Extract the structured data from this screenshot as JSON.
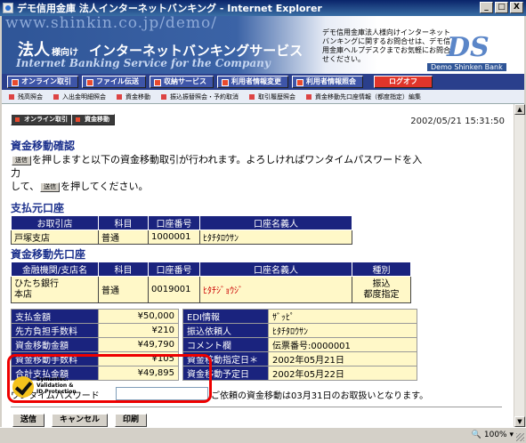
{
  "window": {
    "title": "デモ信用金庫  法人インターネットバンキング - Internet Explorer",
    "min": "_",
    "max": "□",
    "close": "X"
  },
  "header": {
    "url_watermark": "www.shinkin.co.jp/demo/",
    "brand_jp_1": "法人",
    "brand_jp_2": "様向け",
    "brand_jp_3": "インターネットバンキングサービス",
    "brand_en": "Internet Banking Service for the Company",
    "note": "デモ信用金庫法人様向けインターネットバンキングに関するお問合せは、デモ信用金庫ヘルプデスクまでお気軽にお問合せください。",
    "logo": "DS",
    "logo_sub": "Demo Shinken Bank"
  },
  "mainnav": [
    "オンライン取引",
    "ファイル伝送",
    "収納サービス",
    "利用者情報変更",
    "利用者情報照会",
    "ログオフ"
  ],
  "subnav": [
    "残高照会",
    "入出金明細照会",
    "資金移動",
    "振込振替照会・予約取消",
    "取引履歴照会",
    "資金移動先口座情報（都度指定）編集"
  ],
  "breadcrumb": [
    "オンライン取引",
    "資金移動"
  ],
  "datetime": "2002/05/21  15:31:50",
  "confirm": {
    "title": "資金移動確認",
    "mini_send": "送信",
    "text1": "を押しますと以下の資金移動取引が行われます。よろしければワンタイムパスワードを入力",
    "text2": "して、",
    "mini_send2": "送信",
    "text3": "を押してください。"
  },
  "source": {
    "title": "支払元口座",
    "headers": [
      "お取引店",
      "科目",
      "口座番号",
      "口座名義人"
    ],
    "row": [
      "戸塚支店",
      "普通",
      "1000001",
      "ﾋﾀﾁﾀﾛｳｻﾝ"
    ]
  },
  "dest": {
    "title": "資金移動先口座",
    "headers": [
      "金融機関/支店名",
      "科目",
      "口座番号",
      "口座名義人",
      "種別"
    ],
    "bank": "ひたち銀行",
    "branch": "本店",
    "subject": "普通",
    "account": "0019001",
    "holder": "ﾋﾀﾁｼﾞｮｳｼﾞ",
    "kind1": "振込",
    "kind2": "都度指定"
  },
  "summary_left": [
    {
      "label": "支払金額",
      "value": "¥50,000"
    },
    {
      "label": "先方負担手数料",
      "value": "¥210"
    },
    {
      "label": "資金移動金額",
      "value": "¥49,790"
    },
    {
      "label": "資金移動手数料",
      "value": "¥105"
    },
    {
      "label": "合計支払金額",
      "value": "¥49,895"
    }
  ],
  "summary_right": [
    {
      "label": "EDI情報",
      "value": "ｻﾞｯﾋﾟ"
    },
    {
      "label": "振込依頼人",
      "value": "ﾋﾀﾁﾀﾛｳｻﾝ"
    },
    {
      "label": "コメント欄",
      "value": "伝票番号:0000001"
    },
    {
      "label": "資金移動指定日＊",
      "value": "2002年05月21日"
    },
    {
      "label": "資金移動予定日",
      "value": "2002年05月22日"
    }
  ],
  "otp": {
    "label": "ワンタイムパスワード",
    "value": "",
    "note": "ご依頼の資金移動は03月31日のお取扱いとなります。"
  },
  "badge": {
    "line1": "Symantec.",
    "line2": "Validation &",
    "line3": "ID Protection"
  },
  "buttons": {
    "send": "送信",
    "cancel": "キャンセル",
    "print": "印刷"
  },
  "status": {
    "zoom": "100%"
  }
}
